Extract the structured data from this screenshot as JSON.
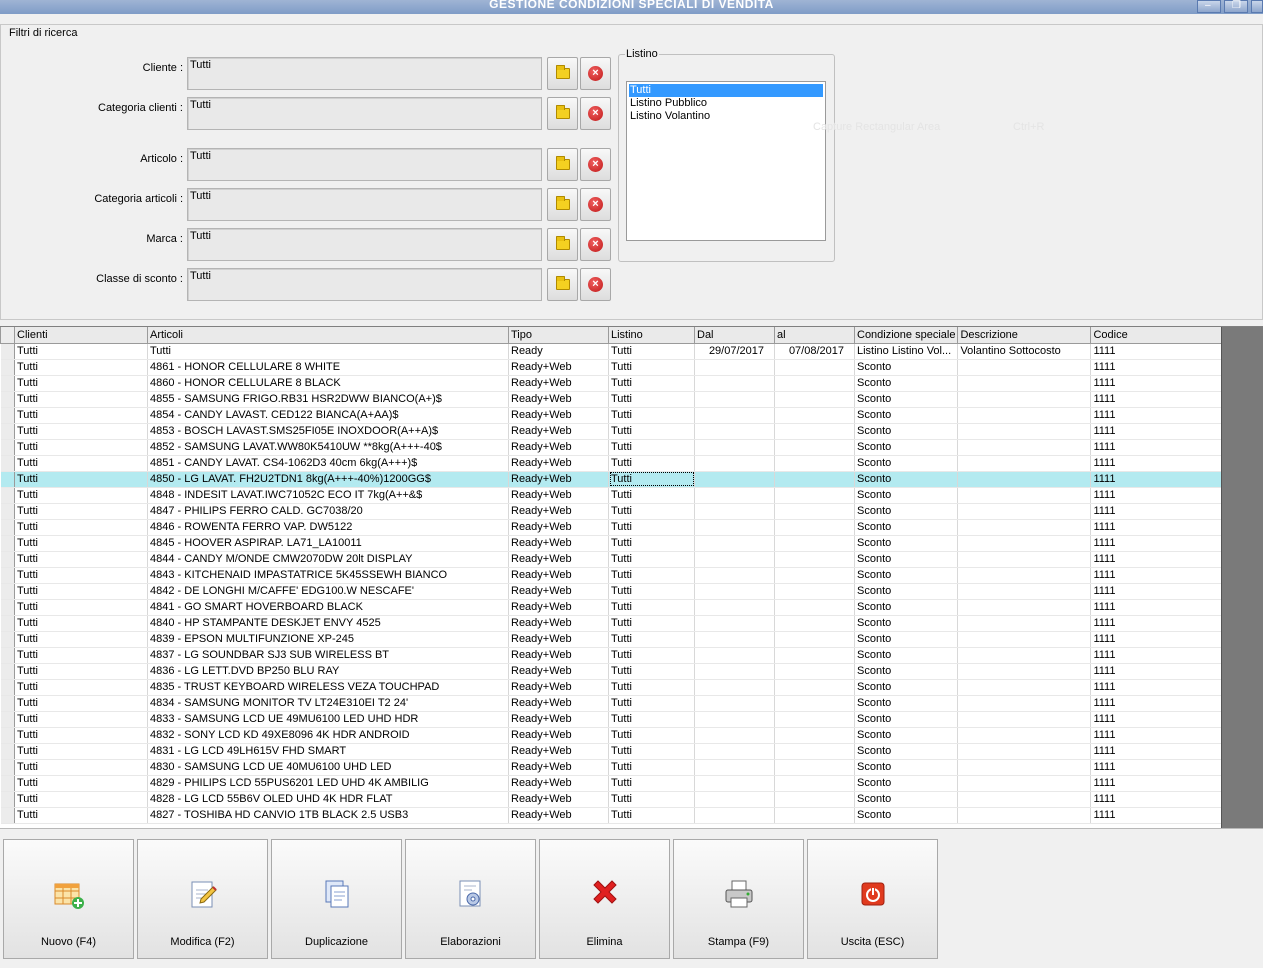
{
  "window": {
    "title": "GESTIONE CONDIZIONI SPECIALI DI VENDITA"
  },
  "filters": {
    "legend": "Filtri di ricerca",
    "rows": [
      {
        "label": "Cliente :",
        "value": "Tutti"
      },
      {
        "label": "Categoria clienti :",
        "value": "Tutti"
      },
      {
        "label": "Articolo :",
        "value": "Tutti"
      },
      {
        "label": "Categoria articoli :",
        "value": "Tutti"
      },
      {
        "label": "Marca :",
        "value": "Tutti"
      },
      {
        "label": "Classe di sconto :",
        "value": "Tutti"
      }
    ],
    "listino": {
      "legend": "Listino",
      "items": [
        "Tutti",
        "Listino Pubblico",
        "Listino Volantino"
      ],
      "selected": "Tutti"
    },
    "ghost_menu": {
      "label": "Capture Rectangular Area",
      "shortcut": "Ctrl+R"
    }
  },
  "grid": {
    "columns": [
      "Clienti",
      "Articoli",
      "Tipo",
      "Listino",
      "Dal",
      "al",
      "Condizione speciale",
      "Descrizione",
      "Codice"
    ],
    "rows": [
      [
        "Tutti",
        "Tutti",
        "Ready",
        "Tutti",
        "29/07/2017",
        "07/08/2017",
        "Listino Listino Vol...",
        "Volantino Sottocosto",
        "1111"
      ],
      [
        "Tutti",
        "4861 - HONOR CELLULARE 8 WHITE",
        "Ready+Web",
        "Tutti",
        "",
        "",
        "Sconto",
        "",
        "1111"
      ],
      [
        "Tutti",
        "4860 - HONOR CELLULARE 8 BLACK",
        "Ready+Web",
        "Tutti",
        "",
        "",
        "Sconto",
        "",
        "1111"
      ],
      [
        "Tutti",
        "4855 - SAMSUNG FRIGO.RB31 HSR2DWW BIANCO(A+)$",
        "Ready+Web",
        "Tutti",
        "",
        "",
        "Sconto",
        "",
        "1111"
      ],
      [
        "Tutti",
        "4854 - CANDY LAVAST. CED122 BIANCA(A+AA)$",
        "Ready+Web",
        "Tutti",
        "",
        "",
        "Sconto",
        "",
        "1111"
      ],
      [
        "Tutti",
        "4853 - BOSCH LAVAST.SMS25FI05E INOXDOOR(A++A)$",
        "Ready+Web",
        "Tutti",
        "",
        "",
        "Sconto",
        "",
        "1111"
      ],
      [
        "Tutti",
        "4852 - SAMSUNG LAVAT.WW80K5410UW **8kg(A+++-40$",
        "Ready+Web",
        "Tutti",
        "",
        "",
        "Sconto",
        "",
        "1111"
      ],
      [
        "Tutti",
        "4851 - CANDY LAVAT. CS4-1062D3 40cm 6kg(A+++)$",
        "Ready+Web",
        "Tutti",
        "",
        "",
        "Sconto",
        "",
        "1111"
      ],
      [
        "Tutti",
        "4850 - LG LAVAT. FH2U2TDN1 8kg(A+++-40%)1200GG$",
        "Ready+Web",
        "Tutti",
        "",
        "",
        "Sconto",
        "",
        "1111"
      ],
      [
        "Tutti",
        "4848 - INDESIT LAVAT.IWC71052C ECO IT 7kg(A++&$",
        "Ready+Web",
        "Tutti",
        "",
        "",
        "Sconto",
        "",
        "1111"
      ],
      [
        "Tutti",
        "4847 - PHILIPS FERRO CALD. GC7038/20",
        "Ready+Web",
        "Tutti",
        "",
        "",
        "Sconto",
        "",
        "1111"
      ],
      [
        "Tutti",
        "4846 - ROWENTA FERRO VAP. DW5122",
        "Ready+Web",
        "Tutti",
        "",
        "",
        "Sconto",
        "",
        "1111"
      ],
      [
        "Tutti",
        "4845 - HOOVER ASPIRAP. LA71_LA10011",
        "Ready+Web",
        "Tutti",
        "",
        "",
        "Sconto",
        "",
        "1111"
      ],
      [
        "Tutti",
        "4844 - CANDY M/ONDE CMW2070DW 20lt DISPLAY",
        "Ready+Web",
        "Tutti",
        "",
        "",
        "Sconto",
        "",
        "1111"
      ],
      [
        "Tutti",
        "4843 - KITCHENAID IMPASTATRICE 5K45SSEWH BIANCO",
        "Ready+Web",
        "Tutti",
        "",
        "",
        "Sconto",
        "",
        "1111"
      ],
      [
        "Tutti",
        "4842 - DE LONGHI M/CAFFE' EDG100.W NESCAFE'",
        "Ready+Web",
        "Tutti",
        "",
        "",
        "Sconto",
        "",
        "1111"
      ],
      [
        "Tutti",
        "4841 - GO SMART HOVERBOARD BLACK",
        "Ready+Web",
        "Tutti",
        "",
        "",
        "Sconto",
        "",
        "1111"
      ],
      [
        "Tutti",
        "4840 - HP STAMPANTE DESKJET ENVY 4525",
        "Ready+Web",
        "Tutti",
        "",
        "",
        "Sconto",
        "",
        "1111"
      ],
      [
        "Tutti",
        "4839 - EPSON MULTIFUNZIONE XP-245",
        "Ready+Web",
        "Tutti",
        "",
        "",
        "Sconto",
        "",
        "1111"
      ],
      [
        "Tutti",
        "4837 - LG SOUNDBAR SJ3 SUB WIRELESS BT",
        "Ready+Web",
        "Tutti",
        "",
        "",
        "Sconto",
        "",
        "1111"
      ],
      [
        "Tutti",
        "4836 - LG LETT.DVD BP250 BLU RAY",
        "Ready+Web",
        "Tutti",
        "",
        "",
        "Sconto",
        "",
        "1111"
      ],
      [
        "Tutti",
        "4835 - TRUST KEYBOARD WIRELESS VEZA TOUCHPAD",
        "Ready+Web",
        "Tutti",
        "",
        "",
        "Sconto",
        "",
        "1111"
      ],
      [
        "Tutti",
        "4834 - SAMSUNG MONITOR TV LT24E310EI T2 24'",
        "Ready+Web",
        "Tutti",
        "",
        "",
        "Sconto",
        "",
        "1111"
      ],
      [
        "Tutti",
        "4833 - SAMSUNG LCD UE 49MU6100 LED UHD HDR",
        "Ready+Web",
        "Tutti",
        "",
        "",
        "Sconto",
        "",
        "1111"
      ],
      [
        "Tutti",
        "4832 - SONY LCD KD 49XE8096 4K HDR  ANDROID",
        "Ready+Web",
        "Tutti",
        "",
        "",
        "Sconto",
        "",
        "1111"
      ],
      [
        "Tutti",
        "4831 - LG LCD 49LH615V FHD SMART",
        "Ready+Web",
        "Tutti",
        "",
        "",
        "Sconto",
        "",
        "1111"
      ],
      [
        "Tutti",
        "4830 - SAMSUNG LCD UE 40MU6100 UHD LED",
        "Ready+Web",
        "Tutti",
        "",
        "",
        "Sconto",
        "",
        "1111"
      ],
      [
        "Tutti",
        "4829 - PHILIPS LCD 55PUS6201 LED UHD 4K AMBILIG",
        "Ready+Web",
        "Tutti",
        "",
        "",
        "Sconto",
        "",
        "1111"
      ],
      [
        "Tutti",
        "4828 - LG LCD 55B6V OLED UHD 4K HDR FLAT",
        "Ready+Web",
        "Tutti",
        "",
        "",
        "Sconto",
        "",
        "1111"
      ],
      [
        "Tutti",
        "4827 - TOSHIBA HD CANVIO  1TB BLACK 2.5 USB3",
        "Ready+Web",
        "Tutti",
        "",
        "",
        "Sconto",
        "",
        "1111"
      ]
    ],
    "highlighted_row": 8
  },
  "toolbar": {
    "buttons": [
      {
        "label": "Nuovo (F4)",
        "icon": "new-grid-plus-icon"
      },
      {
        "label": "Modifica (F2)",
        "icon": "edit-pencil-icon"
      },
      {
        "label": "Duplicazione",
        "icon": "duplicate-pages-icon"
      },
      {
        "label": "Elaborazioni",
        "icon": "process-gear-icon"
      },
      {
        "label": "Elimina",
        "icon": "delete-x-icon"
      },
      {
        "label": "Stampa (F9)",
        "icon": "printer-icon"
      },
      {
        "label": "Uscita (ESC)",
        "icon": "exit-power-icon"
      }
    ]
  },
  "colors": {
    "titlebar": "#8aa3cb",
    "highlight_row": "#b3eaf0",
    "listino_selected": "#3399ff",
    "delete_red": "#e02020"
  }
}
